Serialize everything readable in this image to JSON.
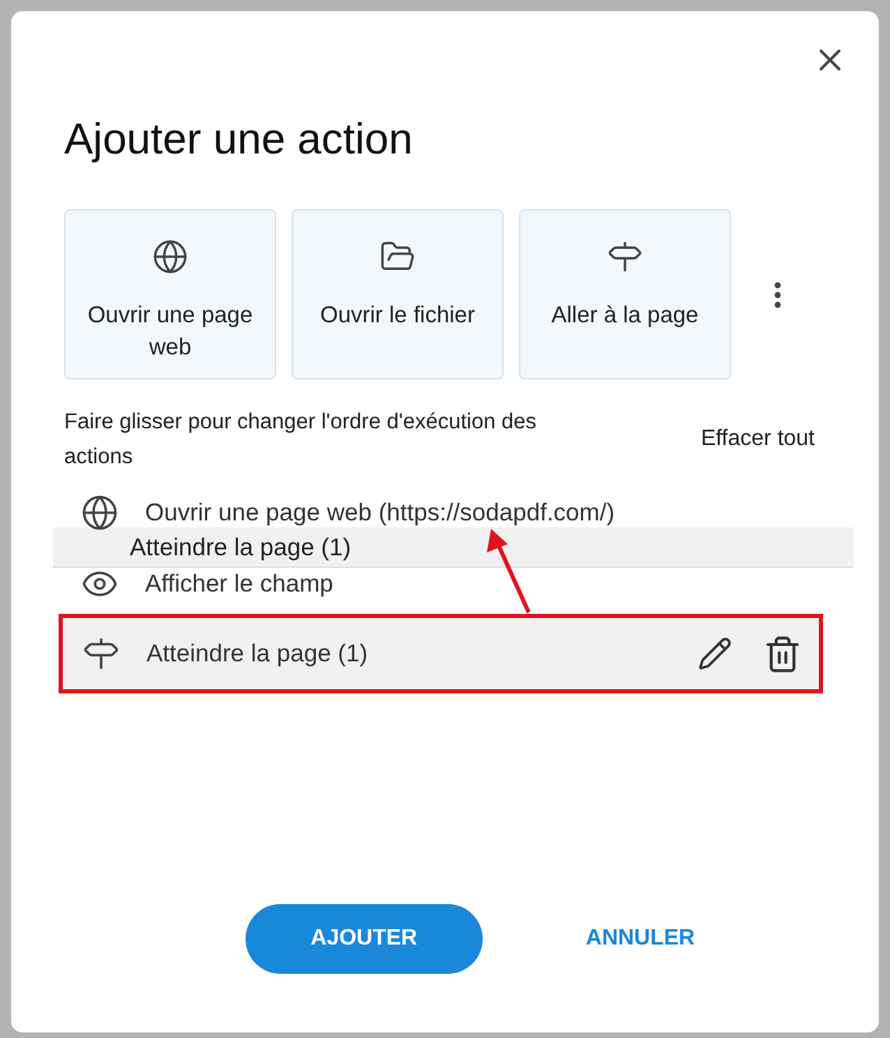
{
  "dialog": {
    "title": "Ajouter une action"
  },
  "quick_actions": [
    {
      "kind": "globe",
      "label": "Ouvrir une page web"
    },
    {
      "kind": "folder",
      "label": "Ouvrir le fichier"
    },
    {
      "kind": "signpost",
      "label": "Aller à la page"
    }
  ],
  "instruction": "Faire glisser pour changer l'ordre d'exécution des actions",
  "clear_all": "Effacer tout",
  "actions": [
    {
      "kind": "globe",
      "label": "Ouvrir une page web (https://sodapdf.com/)",
      "selected": false
    },
    {
      "kind": "eye",
      "label": "Afficher le champ",
      "selected": false
    },
    {
      "kind": "signpost",
      "label": "Atteindre la page (1)",
      "selected": true
    }
  ],
  "drag_ghost": {
    "label": "Atteindre la page (1)"
  },
  "buttons": [
    {
      "kind": "primary",
      "label": "AJOUTER"
    },
    {
      "kind": "text",
      "label": "ANNULER"
    }
  ]
}
